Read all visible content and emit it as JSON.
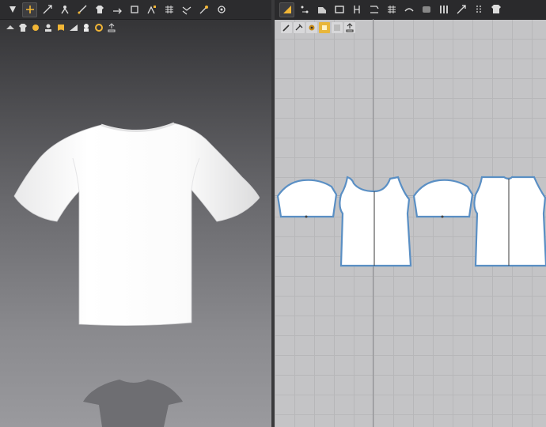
{
  "colors": {
    "accent": "#f2b636",
    "pattern_outline": "#5a8fc4",
    "pattern_fill": "#ffffff",
    "grid_bg": "#c4c4c6",
    "viewport_bg_top": "#2f2f31",
    "viewport_bg_bottom": "#9a9a9e"
  },
  "views": {
    "viewport_3d": {
      "toolbar_icons": [
        "select-move-icon",
        "transform-icon",
        "tack-icon",
        "avatar-pose-icon",
        "measure-icon",
        "fold-icon",
        "arrangement-icon",
        "skin-offset-icon",
        "strengthen-icon",
        "simulate-icon",
        "wrinkle-icon",
        "point-icon",
        "snapshot-icon"
      ],
      "sub_icons": [
        "avatar-show-icon",
        "garment-show-icon",
        "texture-icon",
        "avatar-face-icon",
        "fabric-icon",
        "render-mode-icon",
        "silhouette-icon",
        "color-icon",
        "export-icon"
      ]
    },
    "pattern_2d": {
      "toolbar_icons": [
        "select-pattern-icon",
        "edit-point-icon",
        "pattern-rect-icon",
        "polygon-icon",
        "internal-line-icon",
        "seam-icon",
        "segment-sew-icon",
        "free-sew-icon",
        "fold-arrange-icon",
        "pleat-icon",
        "zipper-icon",
        "button-icon",
        "topstitch-icon"
      ],
      "sub_icons": [
        "trace-icon",
        "clone-icon",
        "fabric-grain-icon",
        "pattern-color-icon",
        "fill-icon",
        "export-pattern-icon"
      ]
    }
  }
}
